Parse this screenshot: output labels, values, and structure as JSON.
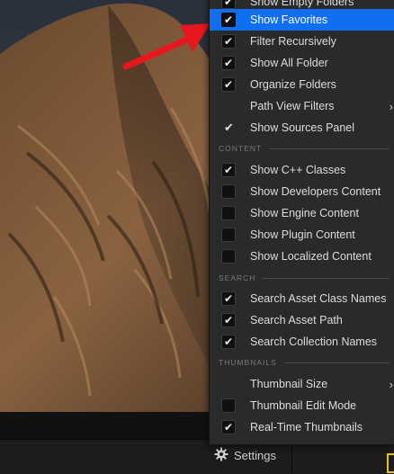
{
  "menu": {
    "items_top": [
      {
        "label": "Show Empty Folders",
        "state": "checked"
      },
      {
        "label": "Show Favorites",
        "state": "checked",
        "highlight": true
      },
      {
        "label": "Filter Recursively",
        "state": "checked"
      },
      {
        "label": "Show All Folder",
        "state": "checked"
      },
      {
        "label": "Organize Folders",
        "state": "checked"
      },
      {
        "label": "Path View Filters",
        "state": "none",
        "submenu": true
      },
      {
        "label": "Show Sources Panel",
        "state": "plain-check"
      }
    ],
    "section_content": "CONTENT",
    "items_content": [
      {
        "label": "Show C++ Classes",
        "state": "checked"
      },
      {
        "label": "Show Developers Content",
        "state": "unchecked"
      },
      {
        "label": "Show Engine Content",
        "state": "unchecked"
      },
      {
        "label": "Show Plugin Content",
        "state": "unchecked"
      },
      {
        "label": "Show Localized Content",
        "state": "unchecked"
      }
    ],
    "section_search": "SEARCH",
    "items_search": [
      {
        "label": "Search Asset Class Names",
        "state": "checked"
      },
      {
        "label": "Search Asset Path",
        "state": "checked"
      },
      {
        "label": "Search Collection Names",
        "state": "checked"
      }
    ],
    "section_thumbnails": "THUMBNAILS",
    "items_thumbnails": [
      {
        "label": "Thumbnail Size",
        "state": "none",
        "submenu": true
      },
      {
        "label": "Thumbnail Edit Mode",
        "state": "unchecked"
      },
      {
        "label": "Real-Time Thumbnails",
        "state": "checked"
      }
    ]
  },
  "footer": {
    "settings_label": "Settings"
  },
  "colors": {
    "highlight": "#0f6ff0",
    "annotation_arrow": "#e8161d",
    "accent_yellow": "#e5c21a"
  }
}
